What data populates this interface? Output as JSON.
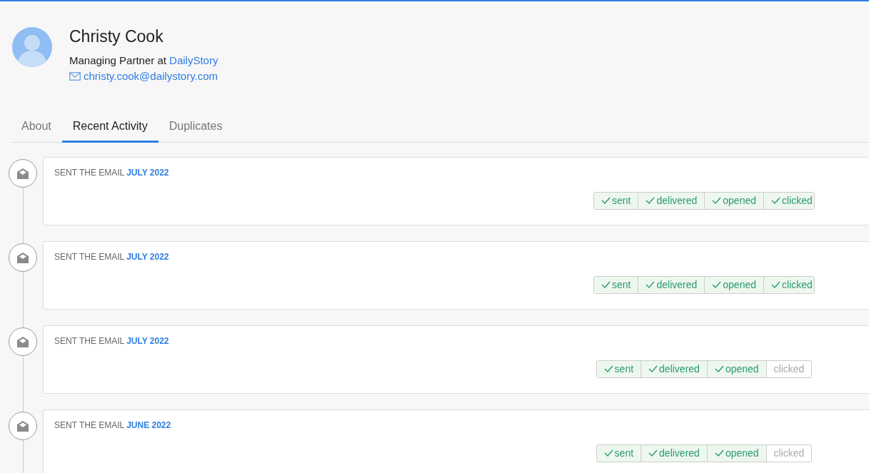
{
  "profile": {
    "name": "Christy Cook",
    "title": "Managing Partner at",
    "company": "DailyStory",
    "email": "christy.cook@dailystory.com"
  },
  "tabs": [
    {
      "label": "About",
      "selected": false
    },
    {
      "label": "Recent Activity",
      "selected": true
    },
    {
      "label": "Duplicates",
      "selected": false
    }
  ],
  "activities": [
    {
      "action": "SENT THE EMAIL",
      "date": "JULY 2022",
      "statuses": [
        {
          "label": "sent",
          "done": true
        },
        {
          "label": "delivered",
          "done": true
        },
        {
          "label": "opened",
          "done": true
        },
        {
          "label": "clicked",
          "done": true
        }
      ]
    },
    {
      "action": "SENT THE EMAIL",
      "date": "JULY 2022",
      "statuses": [
        {
          "label": "sent",
          "done": true
        },
        {
          "label": "delivered",
          "done": true
        },
        {
          "label": "opened",
          "done": true
        },
        {
          "label": "clicked",
          "done": true
        }
      ]
    },
    {
      "action": "SENT THE EMAIL",
      "date": "JULY 2022",
      "statuses": [
        {
          "label": "sent",
          "done": true
        },
        {
          "label": "delivered",
          "done": true
        },
        {
          "label": "opened",
          "done": true
        },
        {
          "label": "clicked",
          "done": false
        }
      ]
    },
    {
      "action": "SENT THE EMAIL",
      "date": "JUNE 2022",
      "statuses": [
        {
          "label": "sent",
          "done": true
        },
        {
          "label": "delivered",
          "done": true
        },
        {
          "label": "opened",
          "done": true
        },
        {
          "label": "clicked",
          "done": false
        }
      ]
    }
  ]
}
